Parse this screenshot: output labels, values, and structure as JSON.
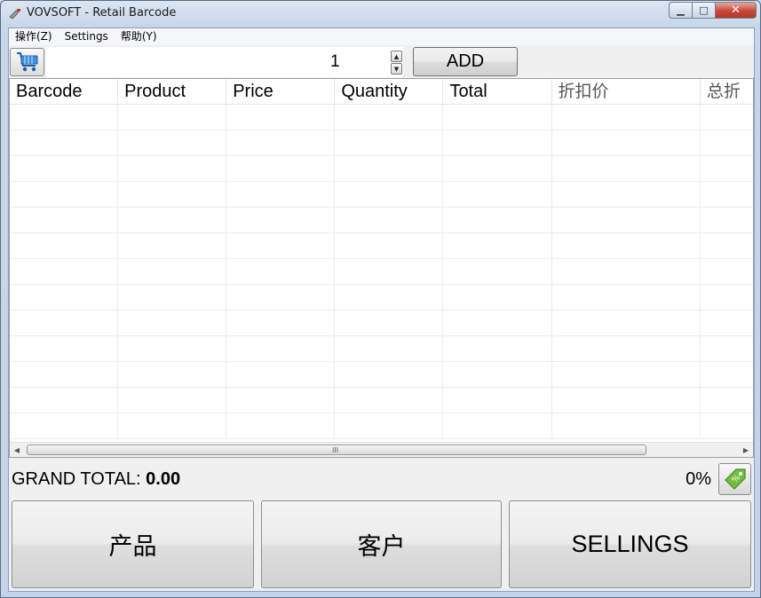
{
  "window": {
    "title": "VOVSOFT - Retail Barcode"
  },
  "menu": [
    "操作(Z)",
    "Settings",
    "帮助(Y)"
  ],
  "toolbar": {
    "barcode_value": "",
    "quantity": "1",
    "add_label": "ADD"
  },
  "grid": {
    "columns": [
      "Barcode",
      "Product",
      "Price",
      "Quantity",
      "Total",
      "折扣价",
      "总折"
    ],
    "rows": [],
    "scroll_grip": "III"
  },
  "totals": {
    "grand_total_label": "GRAND TOTAL:",
    "grand_total_value": "0.00",
    "discount": "0%"
  },
  "actions": {
    "products": "产品",
    "customers": "客户",
    "sellings": "SELLINGS"
  },
  "icons": {
    "cart": "cart-icon",
    "tag": "discount-tag-icon",
    "app": "barcode-scanner-icon"
  },
  "colors": {
    "cart_blue": "#2a7fd4",
    "tag_green": "#6fba3c"
  }
}
